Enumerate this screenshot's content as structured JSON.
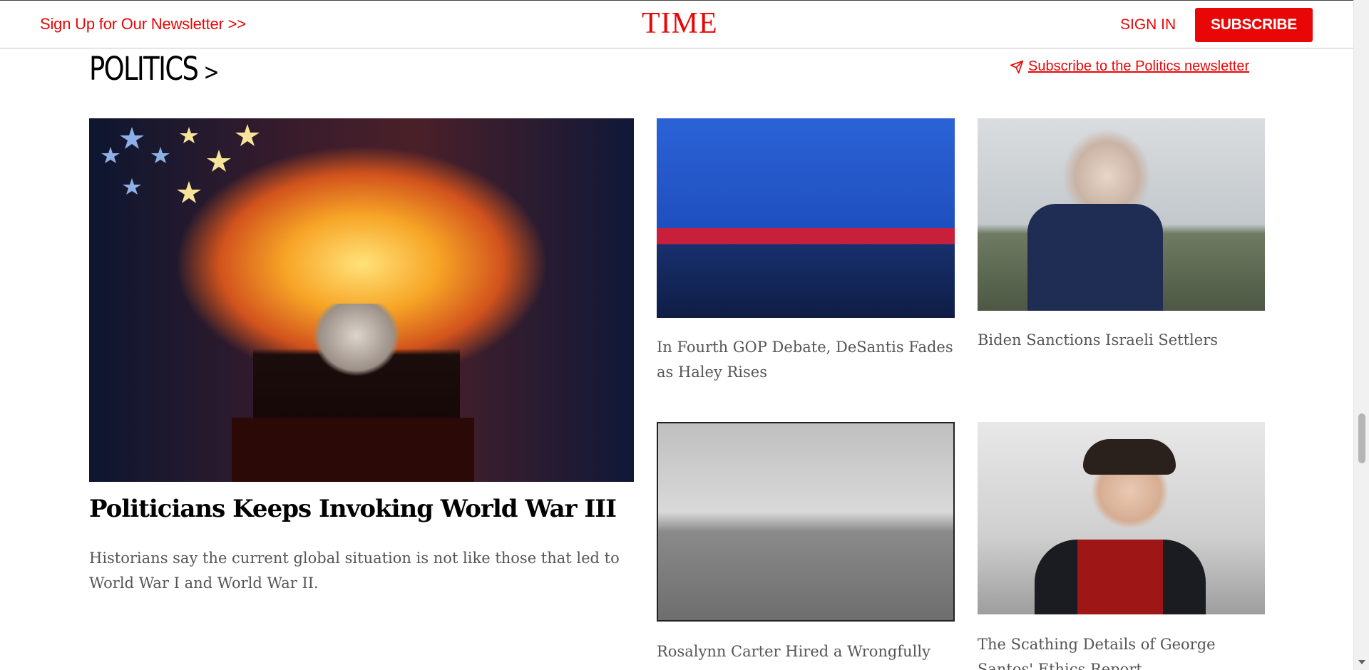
{
  "header": {
    "newsletter_link": "Sign Up for Our Newsletter >>",
    "logo": "TIME",
    "sign_in": "SIGN IN",
    "subscribe": "SUBSCRIBE"
  },
  "section": {
    "title": "POLITICS",
    "chevron": ">",
    "newsletter_link": "Subscribe to the Politics newsletter",
    "newsletter_icon": "paper-plane-icon"
  },
  "hero": {
    "title": "Politicians Keeps Invoking World War III",
    "description": "Historians say the current global situation is not like those that led to World War I and World War II."
  },
  "cards": [
    {
      "title": "In Fourth GOP Debate, DeSantis Fades as Haley Rises"
    },
    {
      "title": "Biden Sanctions Israeli Settlers"
    },
    {
      "title": "Rosalynn Carter Hired a Wrongfully"
    },
    {
      "title": "The Scathing Details of George Santos' Ethics Report"
    }
  ],
  "colors": {
    "brand": "#e90606",
    "muted_text": "#555555"
  }
}
